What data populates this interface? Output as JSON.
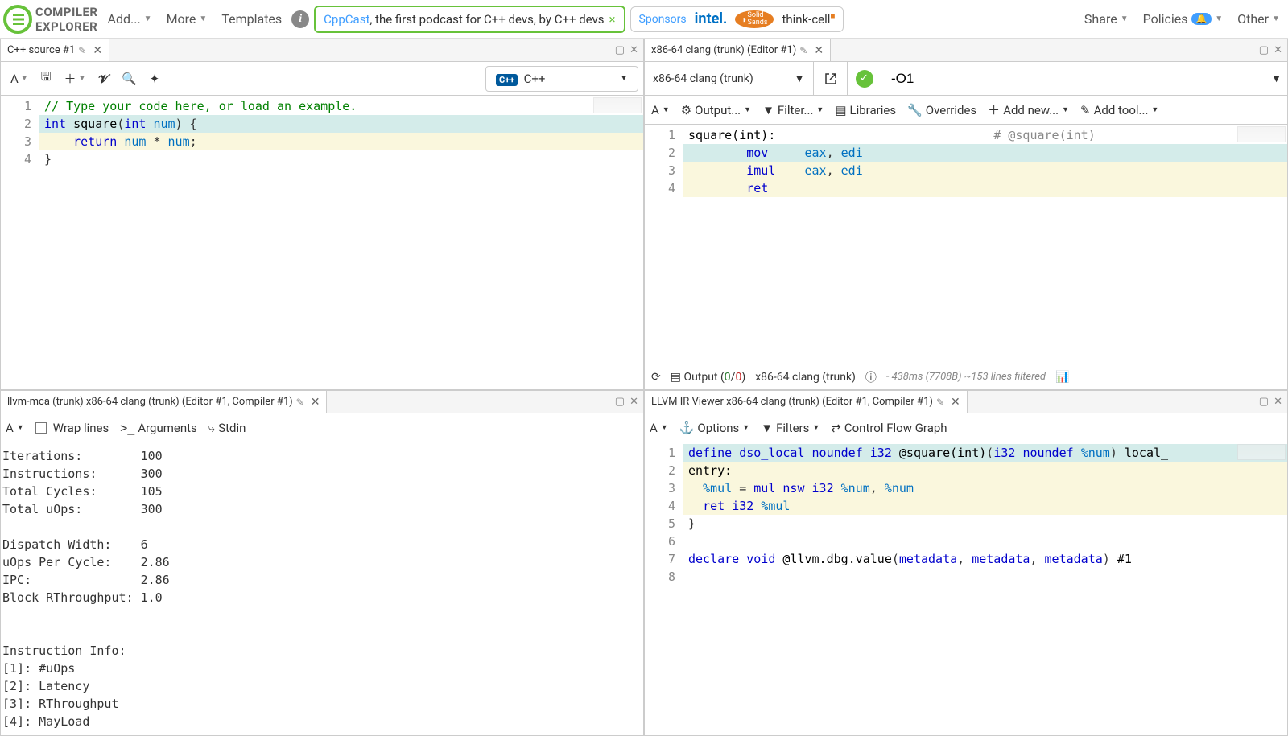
{
  "nav": {
    "add": "Add...",
    "more": "More",
    "templates": "Templates",
    "share": "Share",
    "policies": "Policies",
    "other": "Other"
  },
  "logo": {
    "line1": "COMPILER",
    "line2": "EXPLORER"
  },
  "promo": {
    "brand": "CppCast",
    "text": ", the first podcast for C++ devs, by C++ devs"
  },
  "sponsors": {
    "label": "Sponsors",
    "intel": "intel.",
    "solidsands": "Solid Sands",
    "thinkcell": "think-cell"
  },
  "editor_pane": {
    "tab": "C++ source #1",
    "lang": "C++",
    "lines": [
      {
        "n": 1,
        "type": "comment",
        "text": "// Type your code here, or load an example."
      },
      {
        "n": 2,
        "type": "code",
        "hl": "cyan",
        "html": "kw:int| |fn:square|(|type:int| |var:num|) {"
      },
      {
        "n": 3,
        "type": "code",
        "hl": "yellow",
        "html": "    |kw:return| |var:num| * |var:num|;"
      },
      {
        "n": 4,
        "type": "code",
        "hl": "",
        "html": "}"
      }
    ]
  },
  "asm_pane": {
    "tab": "x86-64 clang (trunk) (Editor #1)",
    "compiler": "x86-64 clang (trunk)",
    "opts": "-O1",
    "toolbar": {
      "output": "Output...",
      "filter": "Filter...",
      "libraries": "Libraries",
      "overrides": "Overrides",
      "addnew": "Add new...",
      "addtool": "Add tool..."
    },
    "lines": [
      {
        "n": 1,
        "hl": "",
        "html": "lbl:square(int):|                              |cm:# @square(int)"
      },
      {
        "n": 2,
        "hl": "cyan",
        "html": "        |kw:mov|     |reg:eax|, |reg:edi"
      },
      {
        "n": 3,
        "hl": "yellow",
        "html": "        |kw:imul|    |reg:eax|, |reg:edi"
      },
      {
        "n": 4,
        "hl": "yellow",
        "html": "        |kw:ret"
      }
    ],
    "status": {
      "output_label": "Output",
      "ok": "0",
      "err": "0",
      "compiler": "x86-64 clang (trunk)",
      "timing": "- 438ms (7708B) ~153 lines filtered"
    }
  },
  "mca_pane": {
    "tab": "llvm-mca (trunk) x86-64 clang (trunk) (Editor #1, Compiler #1)",
    "toolbar": {
      "wrap": "Wrap lines",
      "args": "Arguments",
      "stdin": "Stdin"
    },
    "text": "Iterations:        100\nInstructions:      300\nTotal Cycles:      105\nTotal uOps:        300\n\nDispatch Width:    6\nuOps Per Cycle:    2.86\nIPC:               2.86\nBlock RThroughput: 1.0\n\n\nInstruction Info:\n[1]: #uOps\n[2]: Latency\n[3]: RThroughput\n[4]: MayLoad"
  },
  "ir_pane": {
    "tab": "LLVM IR Viewer x86-64 clang (trunk) (Editor #1, Compiler #1)",
    "toolbar": {
      "options": "Options",
      "filters": "Filters",
      "cfg": "Control Flow Graph"
    },
    "lines": [
      {
        "n": 1,
        "hl": "cyan",
        "html": "kw:define| |kw:dso_local| |kw:noundef| |type:i32| |fn:@square(int)|(|type:i32| |kw:noundef| |var:%num|) |attr:local_"
      },
      {
        "n": 2,
        "hl": "yellow",
        "html": "lbl:entry:"
      },
      {
        "n": 3,
        "hl": "yellow",
        "html": "  |var:%mul| = |kw:mul nsw| |type:i32| |var:%num|, |var:%num"
      },
      {
        "n": 4,
        "hl": "yellow",
        "html": "  |kw:ret| |type:i32| |var:%mul"
      },
      {
        "n": 5,
        "hl": "",
        "html": "}"
      },
      {
        "n": 6,
        "hl": "",
        "html": ""
      },
      {
        "n": 7,
        "hl": "",
        "html": "kw:declare| |kw:void| |fn:@llvm.dbg.value|(|type:metadata|, |type:metadata|, |type:metadata|) |attr:#1"
      },
      {
        "n": 8,
        "hl": "",
        "html": ""
      }
    ]
  }
}
